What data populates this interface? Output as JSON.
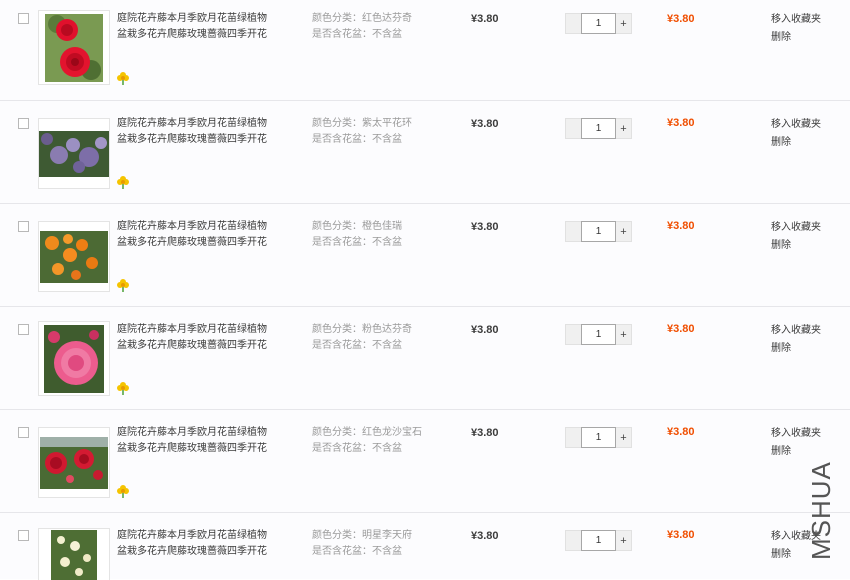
{
  "items": [
    {
      "title_line1": "庭院花卉藤本月季欧月花苗绿植物",
      "title_line2": "盆栽多花卉爬藤玫瑰蔷薇四季开花",
      "prop1": "颜色分类：红色达芬奇",
      "prop2": "是否含花盆：不含盆",
      "unit_price": "¥3.80",
      "quantity": "1",
      "subtotal": "¥3.80",
      "fav_label": "移入收藏夹",
      "delete_label": "删除",
      "image_icon": "red-rose-image",
      "badge_icon": "flower-badge-icon"
    },
    {
      "title_line1": "庭院花卉藤本月季欧月花苗绿植物",
      "title_line2": "盆栽多花卉爬藤玫瑰蔷薇四季开花",
      "prop1": "颜色分类：紫太平花环",
      "prop2": "是否含花盆：不含盆",
      "unit_price": "¥3.80",
      "quantity": "1",
      "subtotal": "¥3.80",
      "fav_label": "移入收藏夹",
      "delete_label": "删除",
      "image_icon": "purple-rose-image",
      "badge_icon": "flower-badge-icon"
    },
    {
      "title_line1": "庭院花卉藤本月季欧月花苗绿植物",
      "title_line2": "盆栽多花卉爬藤玫瑰蔷薇四季开花",
      "prop1": "颜色分类：橙色佳瑞",
      "prop2": "是否含花盆：不含盆",
      "unit_price": "¥3.80",
      "quantity": "1",
      "subtotal": "¥3.80",
      "fav_label": "移入收藏夹",
      "delete_label": "删除",
      "image_icon": "orange-rose-image",
      "badge_icon": "flower-badge-icon"
    },
    {
      "title_line1": "庭院花卉藤本月季欧月花苗绿植物",
      "title_line2": "盆栽多花卉爬藤玫瑰蔷薇四季开花",
      "prop1": "颜色分类：粉色达芬奇",
      "prop2": "是否含花盆：不含盆",
      "unit_price": "¥3.80",
      "quantity": "1",
      "subtotal": "¥3.80",
      "fav_label": "移入收藏夹",
      "delete_label": "删除",
      "image_icon": "pink-rose-image",
      "badge_icon": "flower-badge-icon"
    },
    {
      "title_line1": "庭院花卉藤本月季欧月花苗绿植物",
      "title_line2": "盆栽多花卉爬藤玫瑰蔷薇四季开花",
      "prop1": "颜色分类：红色龙沙宝石",
      "prop2": "是否含花盆：不含盆",
      "unit_price": "¥3.80",
      "quantity": "1",
      "subtotal": "¥3.80",
      "fav_label": "移入收藏夹",
      "delete_label": "删除",
      "image_icon": "red-rose-bush-image",
      "badge_icon": "flower-badge-icon"
    },
    {
      "title_line1": "庭院花卉藤本月季欧月花苗绿植物",
      "title_line2": "盆栽多花卉爬藤玫瑰蔷薇四季开花",
      "prop1": "颜色分类：明星李天府",
      "prop2": "是否含花盆：不含盆",
      "unit_price": "¥3.80",
      "quantity": "1",
      "subtotal": "¥3.80",
      "fav_label": "移入收藏夹",
      "delete_label": "删除",
      "image_icon": "white-rose-image",
      "badge_icon": "flower-badge-icon"
    }
  ],
  "watermark": "MSHUA",
  "colors": {
    "price": "#3c3c3c",
    "subtotal": "#f04e00",
    "property_text": "#9a9a9a",
    "row_bg": "#fcfcfe"
  }
}
